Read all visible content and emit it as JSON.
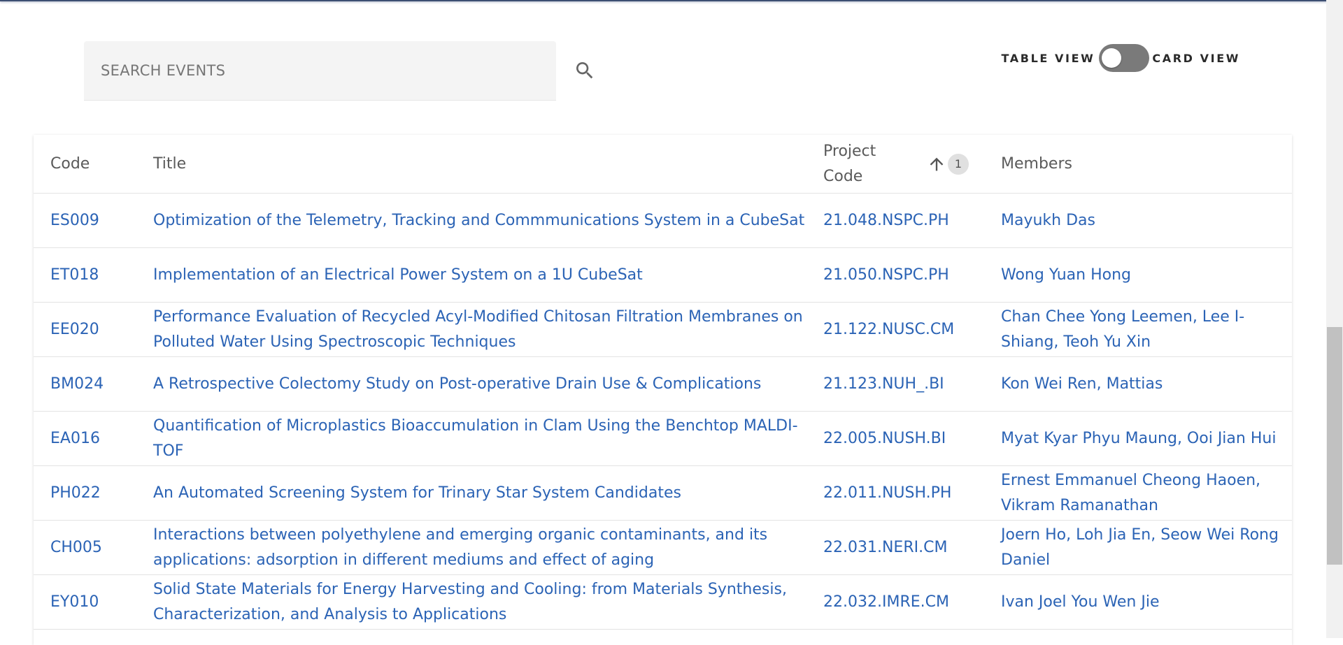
{
  "search": {
    "placeholder": "SEARCH EVENTS",
    "value": ""
  },
  "view_toggle": {
    "left_label": "TABLE VIEW",
    "right_label": "CARD VIEW",
    "state": "table"
  },
  "table": {
    "headers": {
      "code": "Code",
      "title": "Title",
      "project_code": "Project Code",
      "members": "Members"
    },
    "sort": {
      "column": "project_code",
      "direction": "ascending",
      "priority": "1"
    },
    "rows": [
      {
        "code": "ES009",
        "title": "Optimization of the Telemetry, Tracking and Commmunications System in a CubeSat",
        "project_code": "21.048.NSPC.PH",
        "members": "Mayukh Das"
      },
      {
        "code": "ET018",
        "title": "Implementation of an Electrical Power System on a 1U CubeSat",
        "project_code": "21.050.NSPC.PH",
        "members": "Wong Yuan Hong"
      },
      {
        "code": "EE020",
        "title": "Performance Evaluation of Recycled Acyl-Modified Chitosan Filtration Membranes on Polluted Water Using Spectroscopic Techniques",
        "project_code": "21.122.NUSC.CM",
        "members": "Chan Chee Yong Leemen, Lee I-Shiang, Teoh Yu Xin"
      },
      {
        "code": "BM024",
        "title": "A Retrospective Colectomy Study on Post-operative Drain Use & Complications",
        "project_code": "21.123.NUH_.BI",
        "members": "Kon Wei Ren, Mattias"
      },
      {
        "code": "EA016",
        "title": "Quantification of Microplastics Bioaccumulation in Clam Using the Benchtop MALDI-TOF",
        "project_code": "22.005.NUSH.BI",
        "members": "Myat Kyar Phyu Maung, Ooi Jian Hui"
      },
      {
        "code": "PH022",
        "title": "An Automated Screening System for Trinary Star System Candidates",
        "project_code": "22.011.NUSH.PH",
        "members": "Ernest Emmanuel Cheong Haoen, Vikram Ramanathan"
      },
      {
        "code": "CH005",
        "title": "Interactions between polyethylene and emerging organic contaminants, and its applications: adsorption in different mediums and effect of aging",
        "project_code": "22.031.NERI.CM",
        "members": "Joern Ho, Loh Jia En, Seow Wei Rong Daniel"
      },
      {
        "code": "EY010",
        "title": "Solid State Materials for Energy Harvesting and Cooling: from Materials Synthesis, Characterization, and Analysis to Applications",
        "project_code": "22.032.IMRE.CM",
        "members": "Ivan Joel You Wen Jie"
      }
    ]
  },
  "colors": {
    "link": "#2b63b5",
    "header_text": "#5a5a5a",
    "toggle_track": "#7a7a7a",
    "top_bar": "#3d4f73"
  },
  "icons": {
    "search": "search-icon",
    "sort": "arrow-up-icon"
  }
}
